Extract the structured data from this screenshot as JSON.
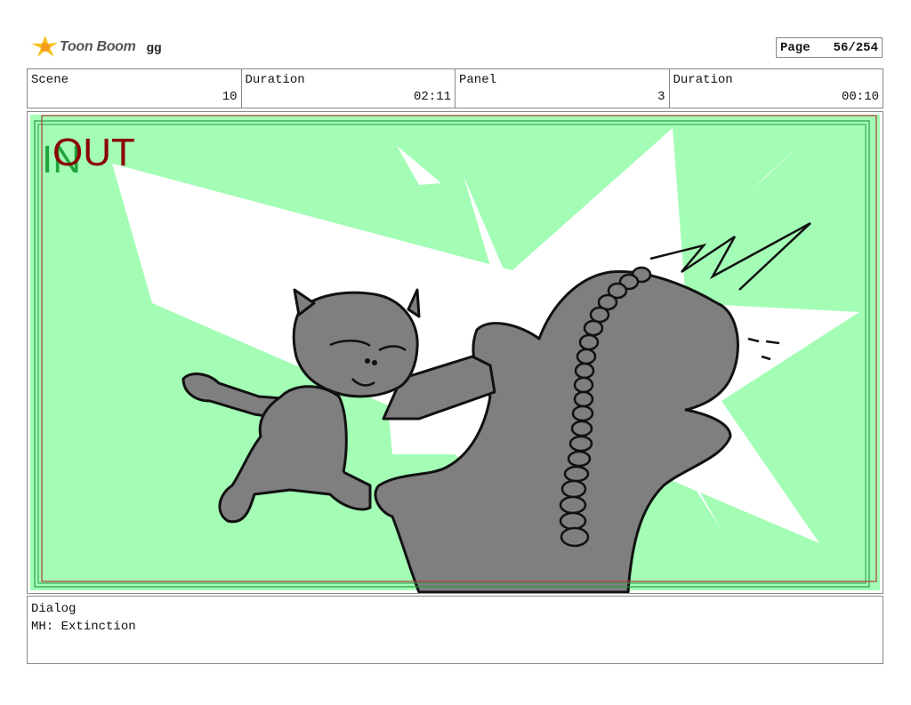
{
  "header": {
    "logo_text": "Toon Boom",
    "project_name": "gg",
    "page_label": "Page",
    "page_value": "56/254"
  },
  "info": [
    {
      "label": "Scene",
      "value": "10"
    },
    {
      "label": "Duration",
      "value": "02:11"
    },
    {
      "label": "Panel",
      "value": "3"
    },
    {
      "label": "Duration",
      "value": "00:10"
    }
  ],
  "panel": {
    "in_marker": "IN",
    "out_marker": "OUT",
    "colors": {
      "background": "#a3fdb5",
      "burst": "#ffffff",
      "figure": "#7f7f7f",
      "in_frame": "#2a9a46",
      "out_frame": "#b03a3a",
      "in_text": "#1fa53b",
      "out_text": "#8b0000"
    }
  },
  "dialog": {
    "label": "Dialog",
    "text": "MH: Extinction"
  }
}
